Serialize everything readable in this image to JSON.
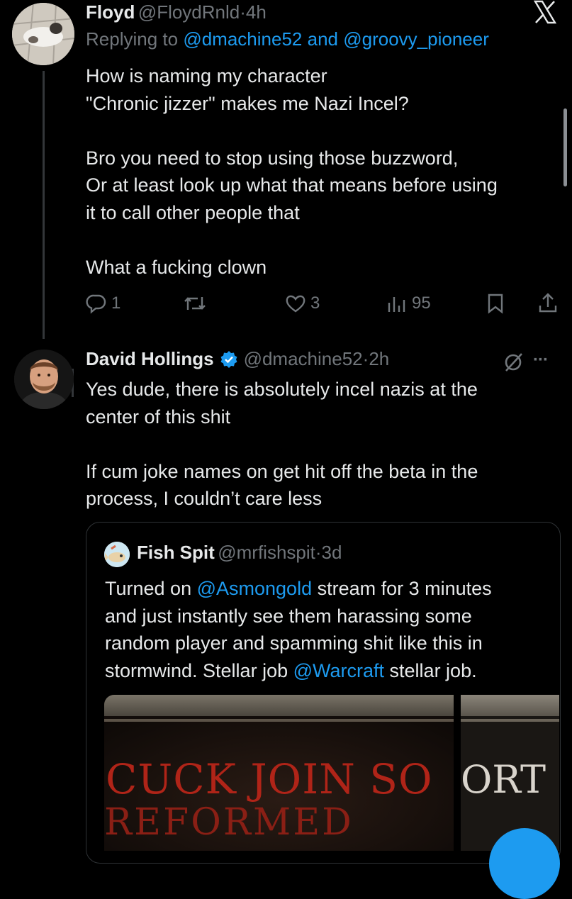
{
  "tweet1": {
    "name": "Floyd",
    "handle": "@FloydRnld",
    "dot": "·",
    "time": "4h",
    "replying_prefix": "Replying to",
    "replying_user1": "@dmachine52",
    "replying_and": "and",
    "replying_user2": "@groovy_pioneer",
    "body": "How is naming my character\n\"Chronic jizzer\" makes me Nazi Incel?\n\nBro you need to stop using those buzzword,\nOr at least look up what that means before using\nit to call other people that\n\nWhat a fucking clown",
    "actions": {
      "replies": "1",
      "likes": "3",
      "views": "95"
    }
  },
  "tweet2": {
    "name": "David Hollings",
    "handle": "@dmachine52",
    "dot": "·",
    "time": "2h",
    "more": "···",
    "body": "Yes dude, there is absolutely incel nazis at the\ncenter of this shit\n\nIf cum joke names on get hit off the beta in the\nprocess, I couldn’t care less"
  },
  "quote": {
    "name": "Fish Spit",
    "handle": "@mrfishspit",
    "dot": "·",
    "time": "3d",
    "body_part1": "Turned on ",
    "mention1": "@Asmongold",
    "body_part2": " stream for 3 minutes\nand just instantly see them harassing some\nrandom player and spamming shit like this in\nstormwind. Stellar job ",
    "mention2": "@Warcraft",
    "body_part3": " stellar job.",
    "media1_line1": "CUCK JOIN SO",
    "media1_line2": "REFORMED",
    "media2_line1": "ORT"
  },
  "icons": {
    "x_logo": "x-logo-icon",
    "reply": "reply-icon",
    "retweet": "retweet-icon",
    "like": "heart-icon",
    "views": "views-icon",
    "bookmark": "bookmark-icon",
    "share": "share-icon",
    "verified": "verified-badge-icon",
    "grok": "slash-circle-icon"
  },
  "colors": {
    "background": "#000000",
    "text": "#e7e9ea",
    "muted": "#71767b",
    "link": "#1d9bf0"
  }
}
